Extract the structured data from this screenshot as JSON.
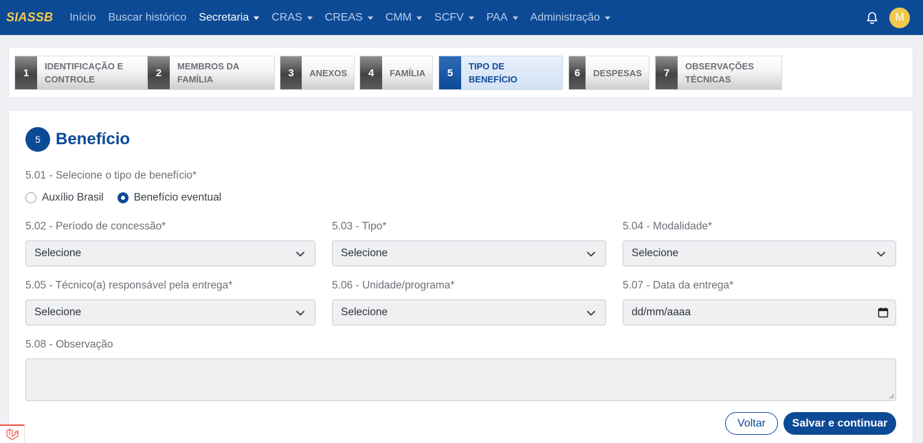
{
  "navbar": {
    "brand": "SIASSB",
    "items": [
      {
        "label": "Início",
        "dropdown": false,
        "active": false
      },
      {
        "label": "Buscar histórico",
        "dropdown": false,
        "active": false
      },
      {
        "label": "Secretaria",
        "dropdown": true,
        "active": true
      },
      {
        "label": "CRAS",
        "dropdown": true,
        "active": false
      },
      {
        "label": "CREAS",
        "dropdown": true,
        "active": false
      },
      {
        "label": "CMM",
        "dropdown": true,
        "active": false
      },
      {
        "label": "SCFV",
        "dropdown": true,
        "active": false
      },
      {
        "label": "PAA",
        "dropdown": true,
        "active": false
      },
      {
        "label": "Administração",
        "dropdown": true,
        "active": false
      }
    ],
    "avatar_initial": "M",
    "bell_icon": "bell-icon",
    "colors": {
      "bar": "#0d4a96",
      "brand": "#f2c94c",
      "avatar": "#f2c94c"
    }
  },
  "stepper": {
    "steps": [
      {
        "num": "1",
        "label_line1": "IDENTIFICAÇÃO E",
        "label_line2": "CONTROLE",
        "active": false
      },
      {
        "num": "2",
        "label_line1": "MEMBROS DA",
        "label_line2": "FAMÍLIA",
        "active": false
      },
      {
        "num": "3",
        "label_line1": "ANEXOS",
        "label_line2": "",
        "active": false
      },
      {
        "num": "4",
        "label_line1": "FAMÍLIA",
        "label_line2": "",
        "active": false
      },
      {
        "num": "5",
        "label_line1": "TIPO DE BENEFÍCIO",
        "label_line2": "",
        "active": true
      },
      {
        "num": "6",
        "label_line1": "DESPESAS",
        "label_line2": "",
        "active": false
      },
      {
        "num": "7",
        "label_line1": "OBSERVAÇÕES",
        "label_line2": "TÉCNICAS",
        "active": false
      }
    ]
  },
  "form": {
    "section_number": "5",
    "section_title": "Benefício",
    "q501": {
      "label": "5.01 - Selecione o tipo de benefício*",
      "options": [
        {
          "label": "Auxílio Brasil",
          "checked": false
        },
        {
          "label": "Benefício eventual",
          "checked": true
        }
      ]
    },
    "q502": {
      "label": "5.02 - Período de concessão*",
      "value": "Selecione"
    },
    "q503": {
      "label": "5.03 - Tipo*",
      "value": "Selecione"
    },
    "q504": {
      "label": "5.04 - Modalidade*",
      "value": "Selecione"
    },
    "q505": {
      "label": "5.05 - Técnico(a) responsável pela entrega*",
      "value": "Selecione"
    },
    "q506": {
      "label": "5.06 - Unidade/programa*",
      "value": "Selecione"
    },
    "q507": {
      "label": "5.07 - Data da entrega*",
      "placeholder": "dd/mm/aaaa"
    },
    "q508": {
      "label": "5.08 - Observação",
      "value": ""
    },
    "buttons": {
      "back": "Voltar",
      "save": "Salvar e continuar"
    }
  }
}
